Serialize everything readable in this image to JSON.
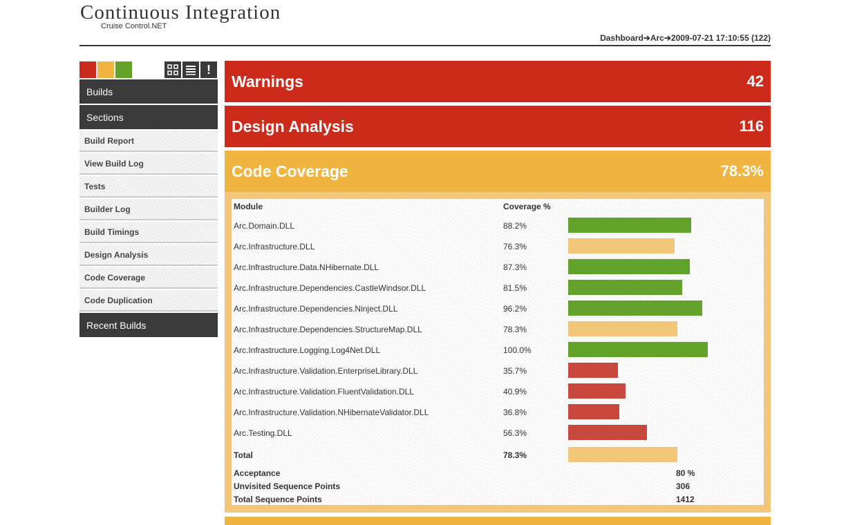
{
  "header": {
    "title": "Continuous Integration",
    "subtitle": "Cruise Control.NET",
    "breadcrumb": "Dashboard➔Arc➔2009-07-21 17:10:55 (122)"
  },
  "status_colors": {
    "failed": "#cc2a1a",
    "warning": "#f0b440",
    "success": "#62a22a"
  },
  "toolbar": {
    "icons": [
      "grid-view-icon",
      "list-view-icon",
      "alert-icon"
    ],
    "alert_glyph": "!"
  },
  "sidebar": {
    "builds": "Builds",
    "sections": "Sections",
    "items": [
      "Build Report",
      "View Build Log",
      "Tests",
      "Builder Log",
      "Build Timings",
      "Design Analysis",
      "Code Coverage",
      "Code Duplication"
    ],
    "recent_builds": "Recent Builds"
  },
  "panels": [
    {
      "title": "Warnings",
      "value": "42"
    },
    {
      "title": "Design Analysis",
      "value": "116"
    },
    {
      "title": "Code Coverage",
      "value": "78.3%"
    }
  ],
  "coverage": {
    "headers": {
      "module": "Module",
      "coverage": "Coverage %"
    },
    "rows": [
      {
        "module": "Arc.Domain.DLL",
        "pct": "88.2%",
        "value": 88.2
      },
      {
        "module": "Arc.Infrastructure.DLL",
        "pct": "76.3%",
        "value": 76.3
      },
      {
        "module": "Arc.Infrastructure.Data.NHibernate.DLL",
        "pct": "87.3%",
        "value": 87.3
      },
      {
        "module": "Arc.Infrastructure.Dependencies.CastleWindsor.DLL",
        "pct": "81.5%",
        "value": 81.5
      },
      {
        "module": "Arc.Infrastructure.Dependencies.Ninject.DLL",
        "pct": "96.2%",
        "value": 96.2
      },
      {
        "module": "Arc.Infrastructure.Dependencies.StructureMap.DLL",
        "pct": "78.3%",
        "value": 78.3
      },
      {
        "module": "Arc.Infrastructure.Logging.Log4Net.DLL",
        "pct": "100.0%",
        "value": 100.0
      },
      {
        "module": "Arc.Infrastructure.Validation.EnterpriseLibrary.DLL",
        "pct": "35.7%",
        "value": 35.7
      },
      {
        "module": "Arc.Infrastructure.Validation.FluentValidation.DLL",
        "pct": "40.9%",
        "value": 40.9
      },
      {
        "module": "Arc.Infrastructure.Validation.NHibernateValidator.DLL",
        "pct": "36.8%",
        "value": 36.8
      },
      {
        "module": "Arc.Testing.DLL",
        "pct": "56.3%",
        "value": 56.3
      }
    ],
    "total": {
      "label": "Total",
      "pct": "78.3%",
      "value": 78.3
    },
    "thresholds": {
      "good": 80,
      "mid": 70
    },
    "stats": [
      {
        "label": "Acceptance",
        "value": "80 %"
      },
      {
        "label": "Unvisited Sequence Points",
        "value": "306"
      },
      {
        "label": "Total Sequence Points",
        "value": "1412"
      }
    ]
  }
}
